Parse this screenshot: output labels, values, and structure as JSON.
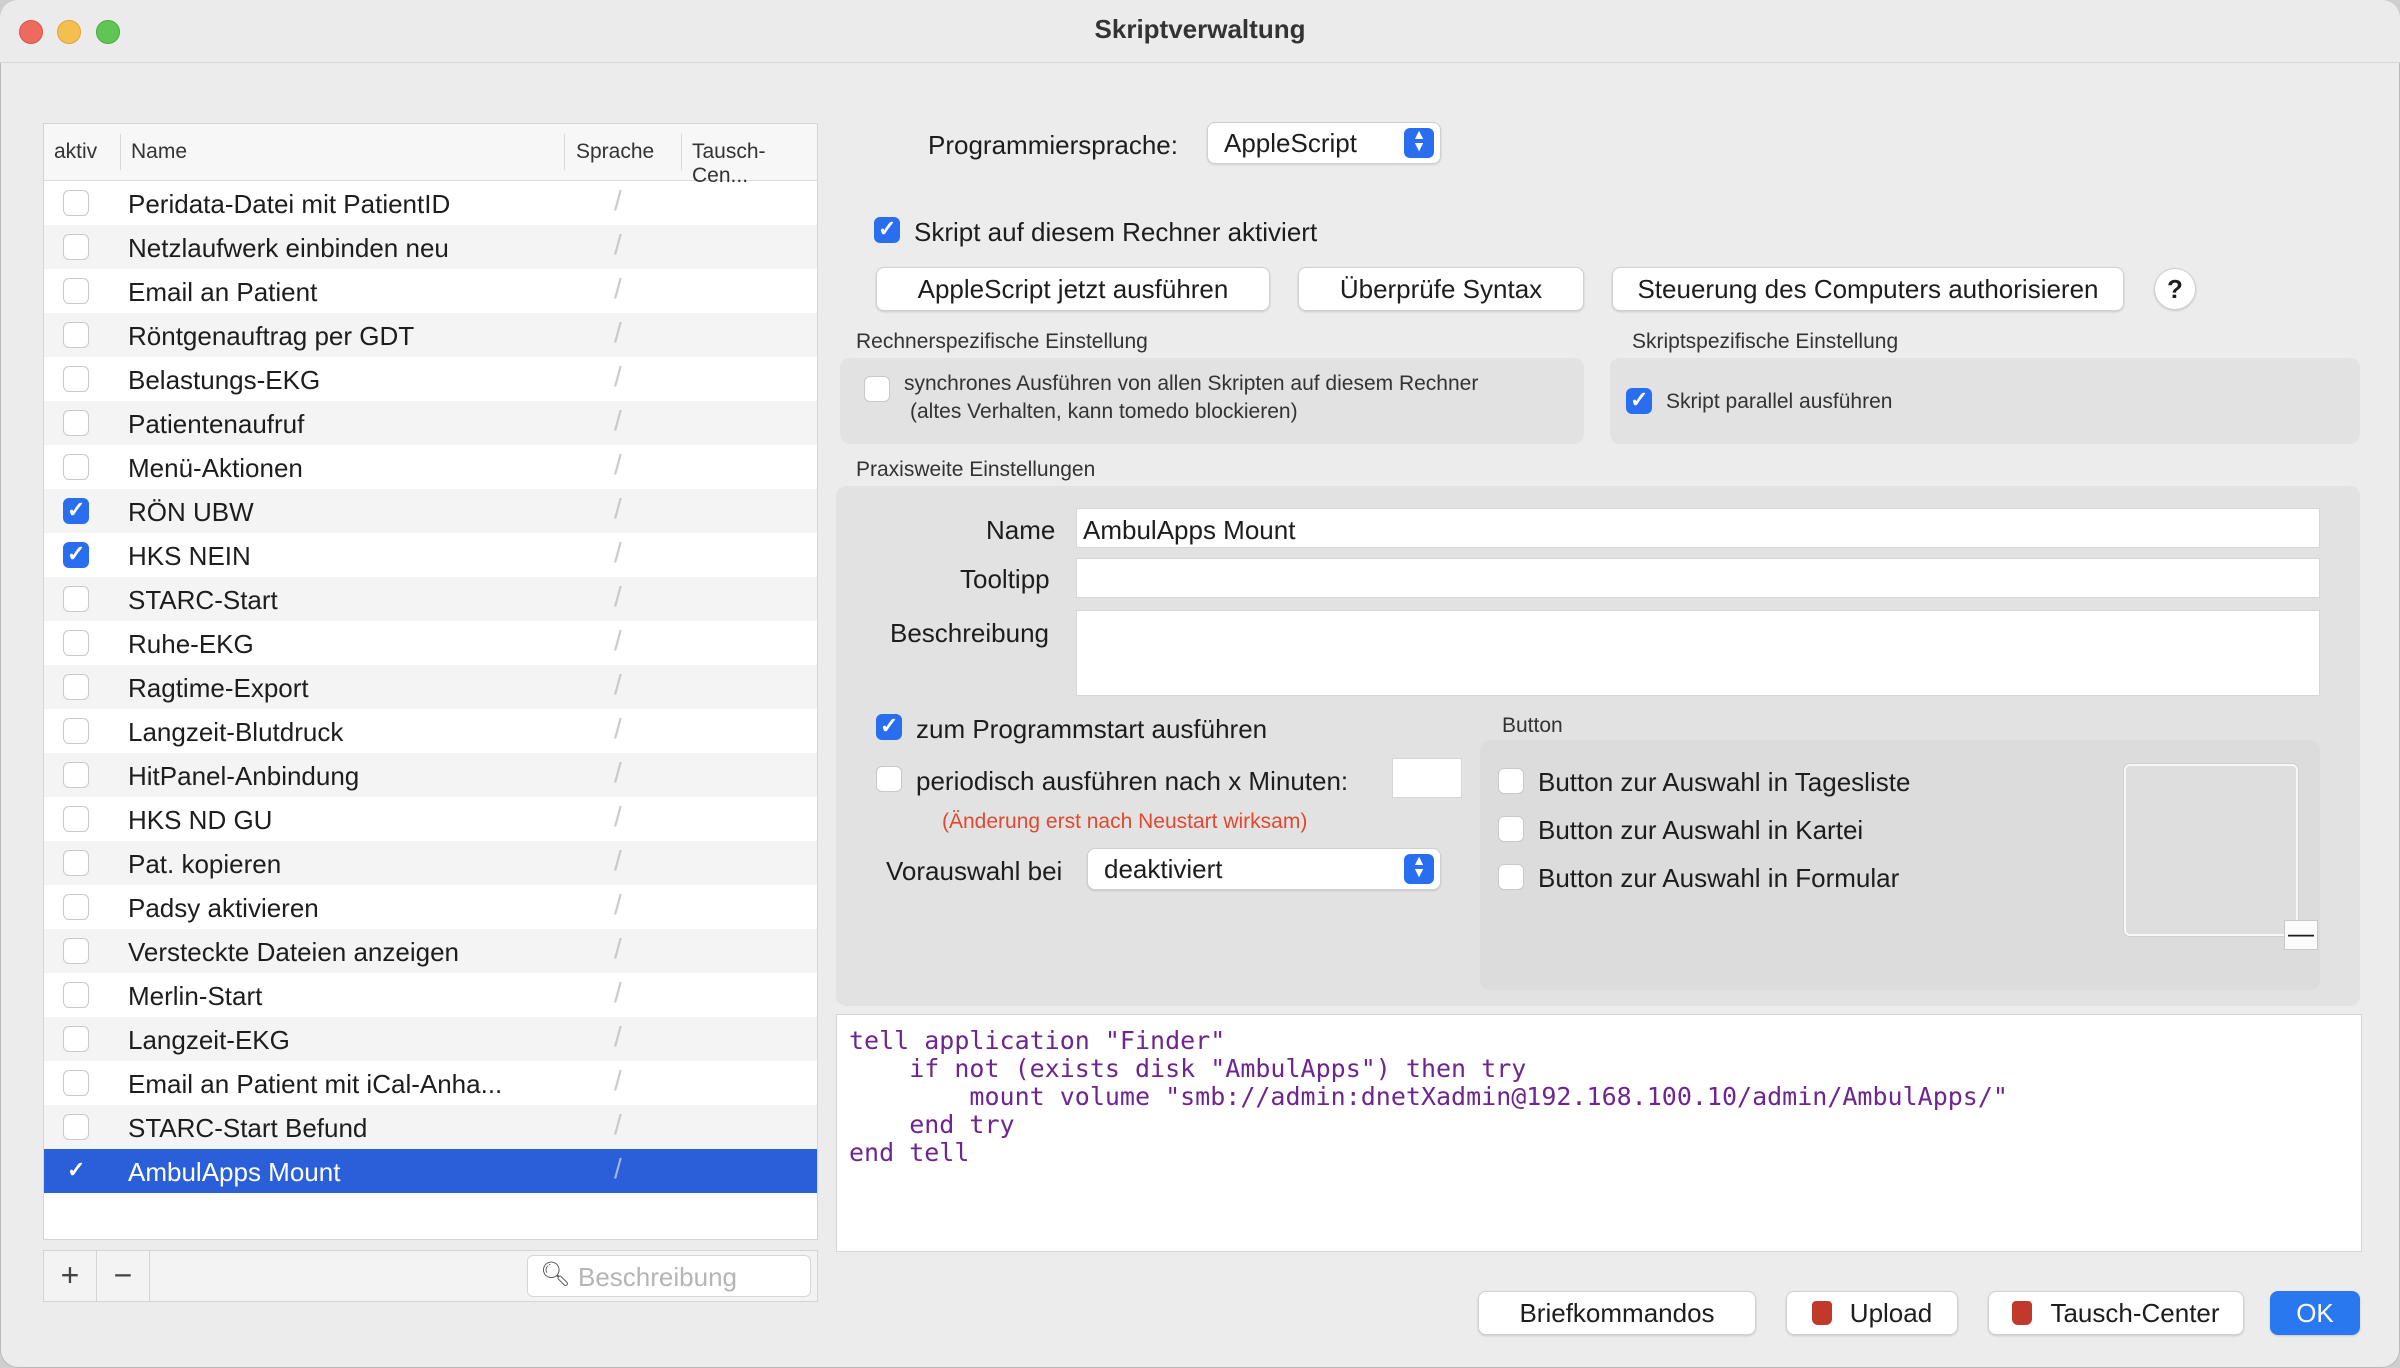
{
  "window": {
    "title": "Skriptverwaltung"
  },
  "list": {
    "headers": {
      "active": "aktiv",
      "name": "Name",
      "language": "Sprache",
      "exchange": "Tausch-Cen..."
    },
    "items": [
      {
        "name": "Peridata-Datei mit PatientID",
        "active": false
      },
      {
        "name": "Netzlaufwerk einbinden neu",
        "active": false
      },
      {
        "name": "Email an Patient",
        "active": false
      },
      {
        "name": "Röntgenauftrag per GDT",
        "active": false
      },
      {
        "name": "Belastungs-EKG",
        "active": false
      },
      {
        "name": "Patientenaufruf",
        "active": false
      },
      {
        "name": "Menü-Aktionen",
        "active": false
      },
      {
        "name": "RÖN UBW",
        "active": true
      },
      {
        "name": "HKS NEIN",
        "active": true
      },
      {
        "name": "STARC-Start",
        "active": false
      },
      {
        "name": "Ruhe-EKG",
        "active": false
      },
      {
        "name": "Ragtime-Export",
        "active": false
      },
      {
        "name": "Langzeit-Blutdruck",
        "active": false
      },
      {
        "name": "HitPanel-Anbindung",
        "active": false
      },
      {
        "name": "HKS ND GU",
        "active": false
      },
      {
        "name": "Pat. kopieren",
        "active": false
      },
      {
        "name": "Padsy aktivieren",
        "active": false
      },
      {
        "name": "Versteckte Dateien anzeigen",
        "active": false
      },
      {
        "name": "Merlin-Start",
        "active": false
      },
      {
        "name": "Langzeit-EKG",
        "active": false
      },
      {
        "name": "Email an Patient mit iCal-Anha...",
        "active": false
      },
      {
        "name": "STARC-Start Befund",
        "active": false
      },
      {
        "name": "AmbulApps Mount",
        "active": true,
        "selected": true
      }
    ],
    "footer": {
      "add": "+",
      "remove": "−",
      "search_placeholder": "Beschreibung"
    }
  },
  "settings": {
    "language_label": "Programmiersprache:",
    "language_value": "AppleScript",
    "activated_label": "Skript auf diesem Rechner aktiviert",
    "activated": true,
    "run_button": "AppleScript jetzt ausführen",
    "check_button": "Überprüfe Syntax",
    "authorize_button": "Steuerung des Computers authorisieren",
    "help": "?",
    "machine_section": "Rechnerspezifische Einstellung",
    "sync_line1": "synchrones Ausführen von allen Skripten auf diesem Rechner",
    "sync_line2": "(altes Verhalten, kann tomedo blockieren)",
    "sync": false,
    "script_section": "Skriptspezifische Einstellung",
    "parallel_label": "Skript parallel ausführen",
    "parallel": true,
    "practice_section": "Praxisweite Einstellungen",
    "name_label": "Name",
    "name_value": "AmbulApps Mount",
    "tooltip_label": "Tooltipp",
    "tooltip_value": "",
    "description_label": "Beschreibung",
    "description_value": "",
    "startup_label": "zum Programmstart ausführen",
    "startup": true,
    "periodic_label": "periodisch ausführen nach x Minuten:",
    "periodic": false,
    "periodic_value": "",
    "restart_hint": "(Änderung erst nach Neustart wirksam)",
    "preselect_label": "Vorauswahl bei",
    "preselect_value": "deaktiviert",
    "button_section": "Button",
    "btn_daylist": "Button zur Auswahl in Tagesliste",
    "btn_chart": "Button zur Auswahl in Kartei",
    "btn_form": "Button zur Auswahl in Formular",
    "image_remove": "—"
  },
  "code": {
    "lines": [
      "tell application \"Finder\"",
      "    if not (exists disk \"AmbulApps\") then try",
      "        mount volume \"smb://admin:dnetXadmin@192.168.100.10/admin/AmbulApps/\"",
      "    end try",
      "end tell"
    ]
  },
  "footer_buttons": {
    "letters": "Briefkommandos",
    "upload": "Upload",
    "exchange": "Tausch-Center",
    "ok": "OK"
  },
  "colors": {
    "accent": "#2a6ef0",
    "selection": "#2a5fd9",
    "hint": "#e0492f",
    "code": "#6e2590"
  }
}
